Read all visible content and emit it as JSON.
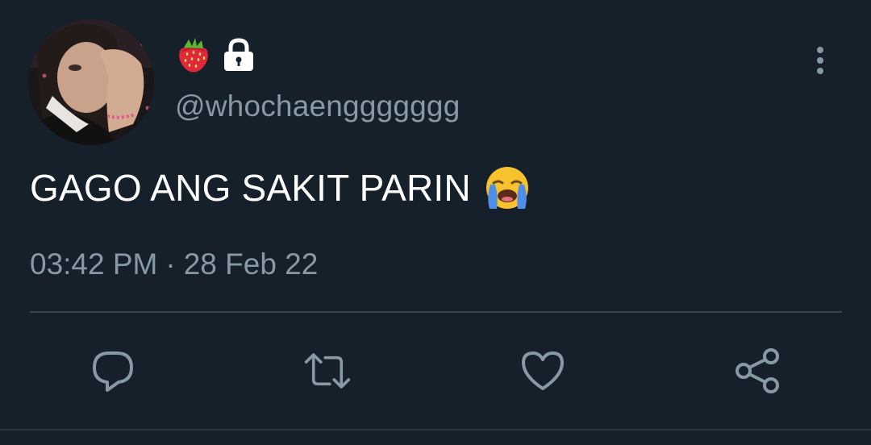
{
  "tweet": {
    "handle": "@whochaenggggggg",
    "text": "GAGO ANG SAKIT PARIN",
    "time": "03:42 PM",
    "separator": "·",
    "date": "28 Feb 22",
    "name_icons": [
      "strawberry-icon",
      "lock-icon"
    ],
    "text_emoji": "loudly-crying-face-icon"
  },
  "actions": [
    "reply-icon",
    "retweet-icon",
    "like-icon",
    "share-icon"
  ],
  "colors": {
    "background": "#15202b",
    "text": "#ffffff",
    "secondary": "#8899a6",
    "divider": "#38444d"
  }
}
